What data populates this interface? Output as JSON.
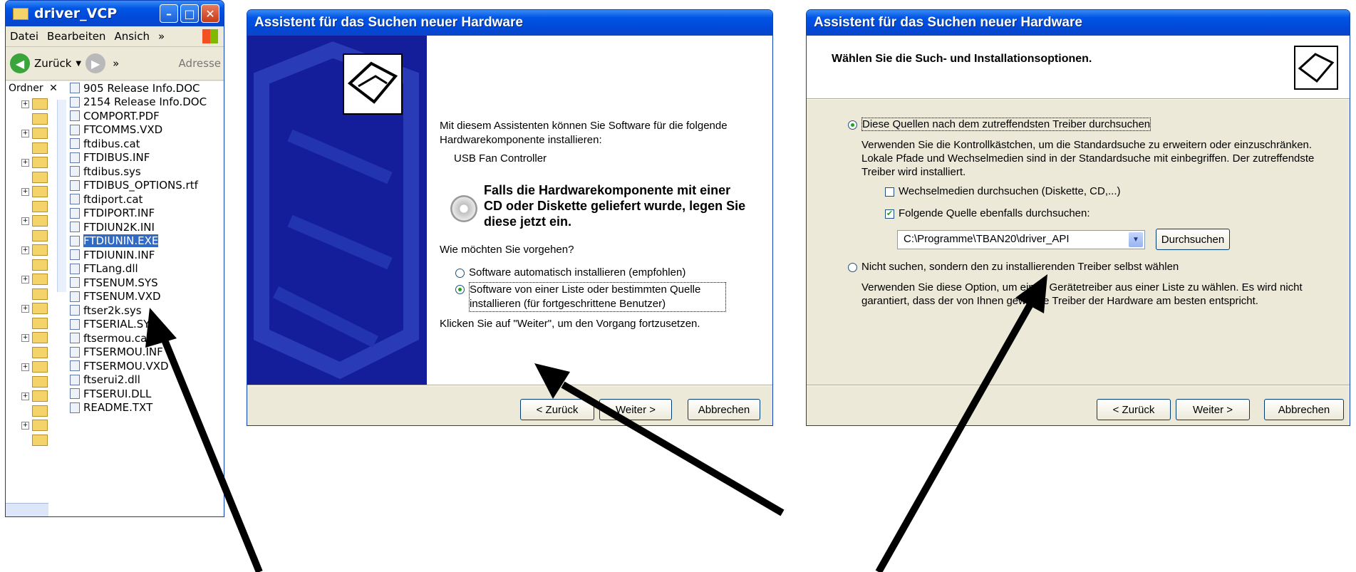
{
  "explorer": {
    "title": "driver_VCP",
    "menu": [
      "Datei",
      "Bearbeiten",
      "Ansich",
      "»"
    ],
    "toolbar": {
      "back": "Zurück",
      "more": "»",
      "address": "Adresse"
    },
    "folders_label": "Ordner",
    "files": [
      {
        "name": "905 Release Info.DOC",
        "selected": false
      },
      {
        "name": "2154 Release Info.DOC",
        "selected": false
      },
      {
        "name": "COMPORT.PDF",
        "selected": false
      },
      {
        "name": "FTCOMMS.VXD",
        "selected": false
      },
      {
        "name": "ftdibus.cat",
        "selected": false
      },
      {
        "name": "FTDIBUS.INF",
        "selected": false
      },
      {
        "name": "ftdibus.sys",
        "selected": false
      },
      {
        "name": "FTDIBUS_OPTIONS.rtf",
        "selected": false
      },
      {
        "name": "ftdiport.cat",
        "selected": false
      },
      {
        "name": "FTDIPORT.INF",
        "selected": false
      },
      {
        "name": "FTDIUN2K.INI",
        "selected": false
      },
      {
        "name": "FTDIUNIN.EXE",
        "selected": true
      },
      {
        "name": "FTDIUNIN.INF",
        "selected": false
      },
      {
        "name": "FTLang.dll",
        "selected": false
      },
      {
        "name": "FTSENUM.SYS",
        "selected": false
      },
      {
        "name": "FTSENUM.VXD",
        "selected": false
      },
      {
        "name": "ftser2k.sys",
        "selected": false
      },
      {
        "name": "FTSERIAL.SYS",
        "selected": false
      },
      {
        "name": "ftsermou.cat",
        "selected": false
      },
      {
        "name": "FTSERMOU.INF",
        "selected": false
      },
      {
        "name": "FTSERMOU.VXD",
        "selected": false
      },
      {
        "name": "ftserui2.dll",
        "selected": false
      },
      {
        "name": "FTSERUI.DLL",
        "selected": false
      },
      {
        "name": "README.TXT",
        "selected": false
      }
    ]
  },
  "wizard1": {
    "title": "Assistent für das Suchen neuer Hardware",
    "intro": "Mit diesem Assistenten können Sie Software für die folgende Hardwarekomponente installieren:",
    "device": "USB Fan Controller",
    "cd_hint": "Falls die Hardwarekomponente mit einer CD oder Diskette geliefert wurde, legen Sie diese jetzt ein.",
    "question": "Wie möchten Sie vorgehen?",
    "option_auto": "Software automatisch installieren (empfohlen)",
    "option_list": "Software von einer Liste oder bestimmten Quelle installieren (für fortgeschrittene Benutzer)",
    "continue_hint": "Klicken Sie auf \"Weiter\", um den Vorgang fortzusetzen.",
    "buttons": {
      "back": "< Zurück",
      "next": "Weiter >",
      "cancel": "Abbrechen"
    }
  },
  "wizard2": {
    "title": "Assistent für das Suchen neuer Hardware",
    "heading": "Wählen Sie die Such- und Installationsoptionen.",
    "option_search": "Diese Quellen nach dem zutreffendsten Treiber durchsuchen",
    "search_desc": "Verwenden Sie die Kontrollkästchen, um die Standardsuche zu erweitern oder einzuschränken. Lokale Pfade und Wechselmedien sind in der Standardsuche mit einbegriffen. Der zutreffendste Treiber wird installiert.",
    "check_removable": "Wechselmedien durchsuchen (Diskette, CD,...)",
    "check_location": "Folgende Quelle ebenfalls durchsuchen:",
    "path_value": "C:\\Programme\\TBAN20\\driver_API",
    "browse": "Durchsuchen",
    "option_manual": "Nicht suchen, sondern den zu installierenden Treiber selbst wählen",
    "manual_desc": "Verwenden Sie diese Option, um einen Gerätetreiber aus einer Liste zu wählen. Es wird nicht garantiert, dass der von Ihnen gewählte Treiber der Hardware am besten entspricht.",
    "buttons": {
      "back": "< Zurück",
      "next": "Weiter >",
      "cancel": "Abbrechen"
    }
  },
  "colors": {
    "xp_blue": "#0054e3",
    "selection": "#316ac5",
    "dialog_bg": "#ece9d8",
    "arrow": "#000000"
  }
}
